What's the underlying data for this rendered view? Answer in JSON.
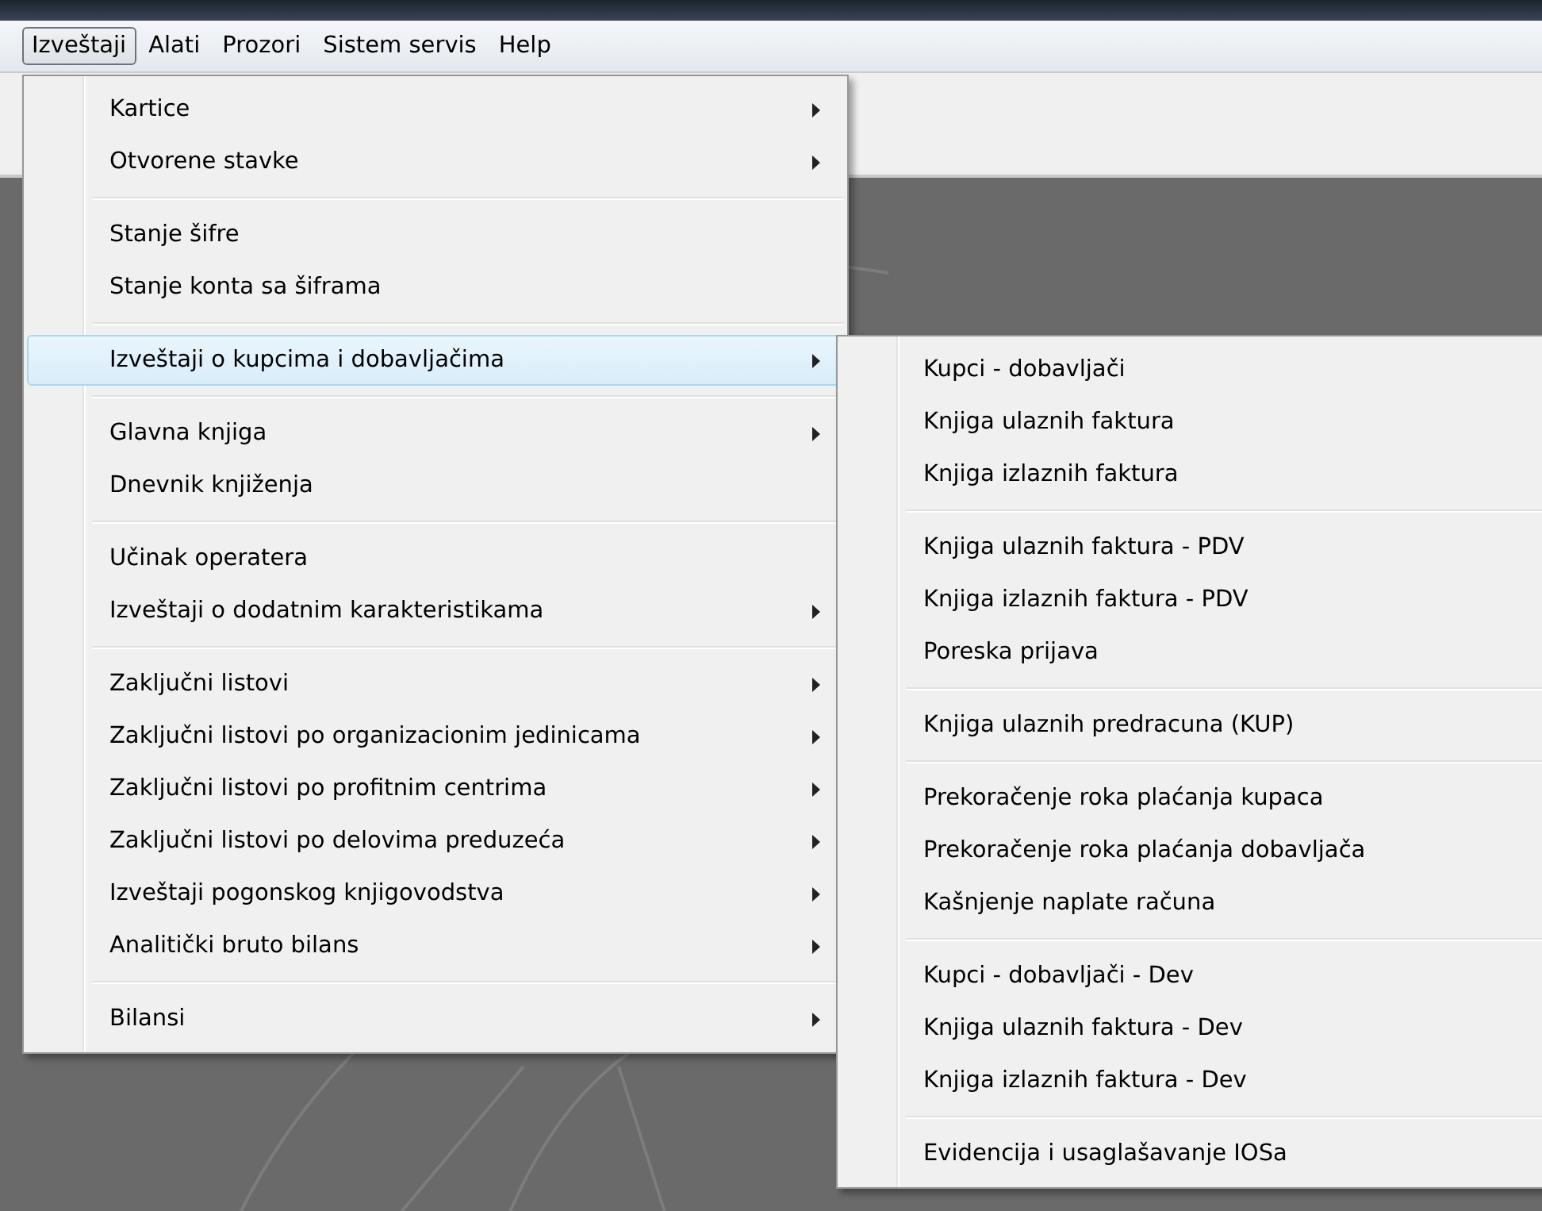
{
  "menubar": {
    "items": [
      {
        "label": "Izveštaji",
        "selected": true
      },
      {
        "label": "Alati",
        "selected": false
      },
      {
        "label": "Prozori",
        "selected": false
      },
      {
        "label": "Sistem servis",
        "selected": false
      },
      {
        "label": "Help",
        "selected": false
      }
    ]
  },
  "menu": {
    "groups": [
      [
        {
          "label": "Kartice",
          "submenu": true,
          "highlighted": false
        },
        {
          "label": "Otvorene stavke",
          "submenu": true,
          "highlighted": false
        }
      ],
      [
        {
          "label": "Stanje šifre",
          "submenu": false,
          "highlighted": false
        },
        {
          "label": "Stanje konta sa šiframa",
          "submenu": false,
          "highlighted": false
        }
      ],
      [
        {
          "label": "Izveštaji o kupcima i dobavljačima",
          "submenu": true,
          "highlighted": true
        }
      ],
      [
        {
          "label": "Glavna knjiga",
          "submenu": true,
          "highlighted": false
        },
        {
          "label": "Dnevnik knjiženja",
          "submenu": false,
          "highlighted": false
        }
      ],
      [
        {
          "label": "Učinak operatera",
          "submenu": false,
          "highlighted": false
        },
        {
          "label": "Izveštaji o dodatnim karakteristikama",
          "submenu": true,
          "highlighted": false
        }
      ],
      [
        {
          "label": "Zaključni listovi",
          "submenu": true,
          "highlighted": false
        },
        {
          "label": "Zaključni listovi po organizacionim jedinicama",
          "submenu": true,
          "highlighted": false
        },
        {
          "label": "Zaključni listovi po profitnim centrima",
          "submenu": true,
          "highlighted": false
        },
        {
          "label": "Zaključni listovi po delovima preduzeća",
          "submenu": true,
          "highlighted": false
        },
        {
          "label": "Izveštaji pogonskog knjigovodstva",
          "submenu": true,
          "highlighted": false
        },
        {
          "label": "Analitički bruto bilans",
          "submenu": true,
          "highlighted": false
        }
      ],
      [
        {
          "label": "Bilansi",
          "submenu": true,
          "highlighted": false
        }
      ]
    ]
  },
  "submenu": {
    "groups": [
      [
        {
          "label": "Kupci - dobavljači",
          "submenu": false,
          "highlighted": false
        },
        {
          "label": "Knjiga ulaznih faktura",
          "submenu": false,
          "highlighted": false
        },
        {
          "label": "Knjiga izlaznih faktura",
          "submenu": false,
          "highlighted": false
        }
      ],
      [
        {
          "label": "Knjiga ulaznih faktura - PDV",
          "submenu": false,
          "highlighted": false
        },
        {
          "label": "Knjiga izlaznih faktura - PDV",
          "submenu": false,
          "highlighted": false
        },
        {
          "label": "Poreska prijava",
          "submenu": false,
          "highlighted": false
        }
      ],
      [
        {
          "label": "Knjiga ulaznih predracuna (KUP)",
          "submenu": false,
          "highlighted": false
        }
      ],
      [
        {
          "label": "Prekoračenje roka plaćanja kupaca",
          "submenu": false,
          "highlighted": false
        },
        {
          "label": "Prekoračenje roka plaćanja dobavljača",
          "submenu": false,
          "highlighted": false
        },
        {
          "label": "Kašnjenje naplate računa",
          "submenu": false,
          "highlighted": false
        }
      ],
      [
        {
          "label": "Kupci - dobavljači - Dev",
          "submenu": false,
          "highlighted": false
        },
        {
          "label": "Knjiga ulaznih faktura - Dev",
          "submenu": false,
          "highlighted": false
        },
        {
          "label": "Knjiga izlaznih faktura - Dev",
          "submenu": false,
          "highlighted": false
        }
      ],
      [
        {
          "label": "Evidencija i usaglašavanje IOSa",
          "submenu": false,
          "highlighted": false
        }
      ]
    ]
  }
}
